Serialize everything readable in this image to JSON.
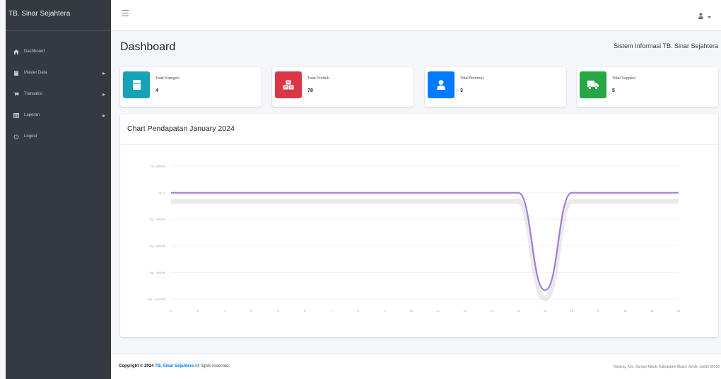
{
  "brand": {
    "name": "TB. Sinar Sejahtera"
  },
  "sidebar": {
    "items": [
      {
        "label": "Dashboard",
        "icon": "home-icon",
        "has_submenu": false
      },
      {
        "label": "Master Data",
        "icon": "book-icon",
        "has_submenu": true
      },
      {
        "label": "Transaksi",
        "icon": "cart-icon",
        "has_submenu": true
      },
      {
        "label": "Laporan",
        "icon": "table-icon",
        "has_submenu": true
      },
      {
        "label": "Logout",
        "icon": "power-icon",
        "has_submenu": false
      }
    ]
  },
  "header": {
    "menu_icon": "hamburger-icon",
    "user_icon": "user-icon",
    "dropdown_icon": "caret-down-icon"
  },
  "page": {
    "title": "Dashboard",
    "subtitle": "Sistem Informasi TB. Sinar Sejahtera"
  },
  "stats": [
    {
      "label": "Total Kategori",
      "value": "4",
      "icon": "file-icon",
      "color": "#17a2b8"
    },
    {
      "label": "Total Produk",
      "value": "78",
      "icon": "cubes-icon",
      "color": "#dc3545"
    },
    {
      "label": "Total Member",
      "value": "3",
      "icon": "user-icon",
      "color": "#007bff"
    },
    {
      "label": "Total Supplier",
      "value": "5",
      "icon": "truck-icon",
      "color": "#28a745"
    }
  ],
  "chart": {
    "title": "Chart Pendapatan January 2024"
  },
  "chart_data": {
    "type": "line",
    "title": "Chart Pendapatan January 2024",
    "x": [
      "1",
      "2",
      "3",
      "4",
      "5",
      "6",
      "7",
      "8",
      "9",
      "10",
      "11",
      "12",
      "13",
      "14",
      "15",
      "16",
      "17",
      "18",
      "19",
      "20"
    ],
    "ylim": [
      -1200000,
      300000
    ],
    "y_ticks": [
      "Rp. 300000",
      "Rp. 0",
      "Rp. -300000",
      "Rp. -600000",
      "Rp. -900000",
      "Rp. -1200000"
    ],
    "series": [
      {
        "values": [
          0,
          0,
          0,
          0,
          0,
          0,
          0,
          0,
          0,
          0,
          0,
          0,
          0,
          0,
          -1100000,
          0,
          0,
          0,
          0,
          0
        ],
        "color": "#7a73d6"
      }
    ],
    "grid": true
  },
  "footer": {
    "prefix": "Copyright © 2024",
    "brand": "TB. Sinar Sejahtera",
    "suffix": "All rights reserved.",
    "address": "Tanjung, Kec. Sungai Tabuk, Kabupaten Muaro Jambi, Jambi 36135"
  }
}
